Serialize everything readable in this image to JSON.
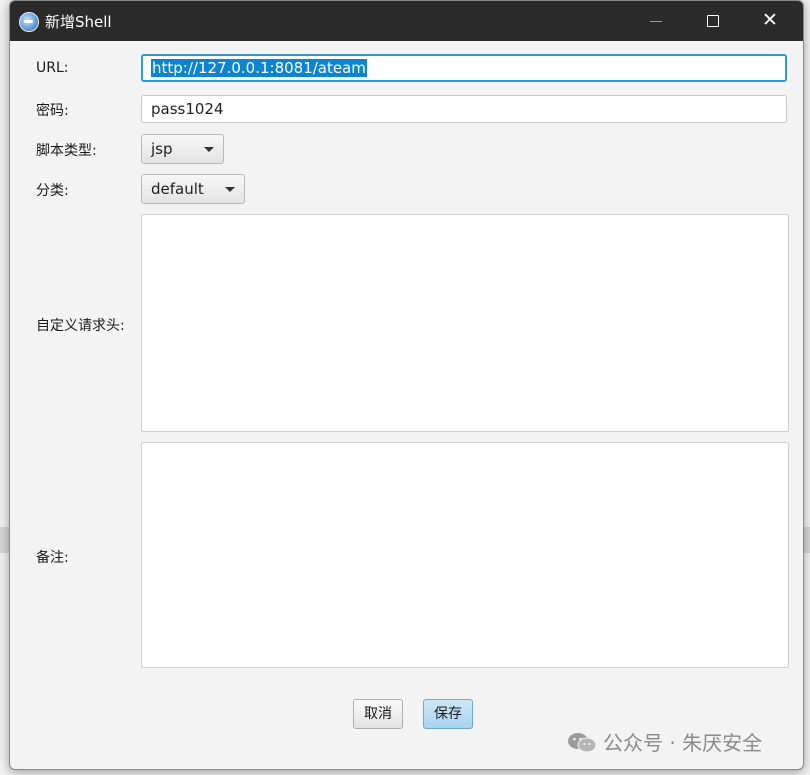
{
  "window": {
    "title": "新增Shell",
    "controls": {
      "minimize": "minimize",
      "maximize": "maximize",
      "close": "✕"
    }
  },
  "form": {
    "url": {
      "label": "URL:",
      "value": "http://127.0.0.1:8081/ateam"
    },
    "password": {
      "label": "密码:",
      "value": "pass1024"
    },
    "script_type": {
      "label": "脚本类型:",
      "selected": "jsp"
    },
    "category": {
      "label": "分类:",
      "selected": "default"
    },
    "custom_headers": {
      "label": "自定义请求头:",
      "value": ""
    },
    "notes": {
      "label": "备注:",
      "value": ""
    }
  },
  "buttons": {
    "cancel": "取消",
    "save": "保存"
  },
  "watermark": {
    "text": "公众号 · 朱厌安全"
  },
  "colors": {
    "titlebar": "#2b2b2b",
    "focus_border": "#2b9ad6",
    "selection": "#0b84d2",
    "primary_button": "#a9d3ef"
  },
  "icons": {
    "app": "globe-shell-icon",
    "minimize": "minimize-icon",
    "maximize": "maximize-icon",
    "close": "close-icon",
    "dropdown": "caret-down-icon",
    "watermark": "wechat-icon"
  }
}
